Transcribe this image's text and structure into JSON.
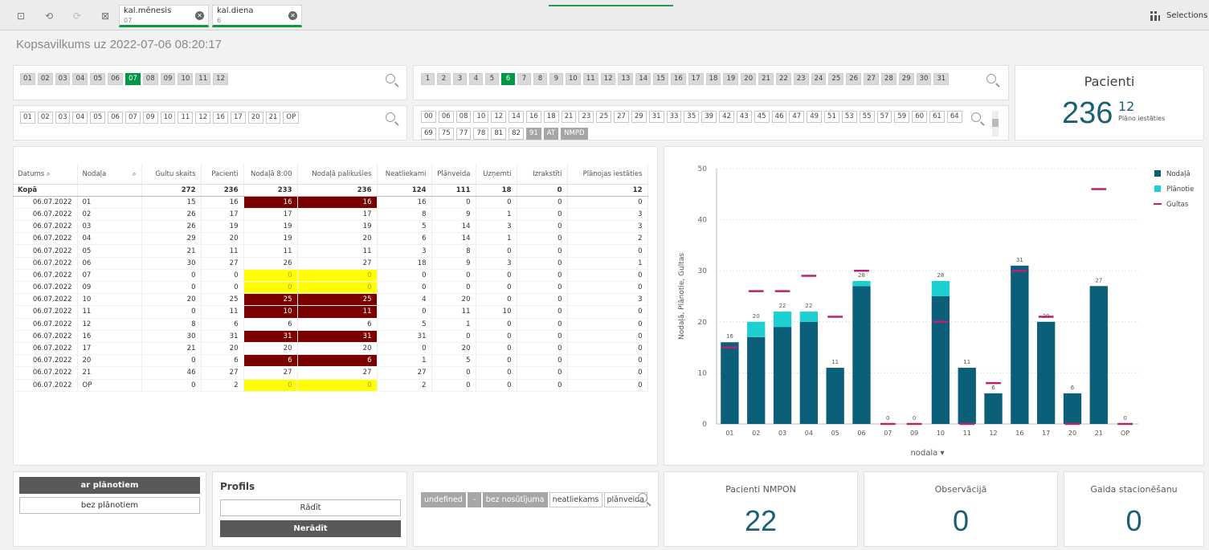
{
  "toolbar": {
    "tabs": [
      {
        "name": "kal.mēnesis",
        "value": "07"
      },
      {
        "name": "kal.diena",
        "value": "6"
      }
    ],
    "selections_label": "Selections"
  },
  "page_title": "Kopsavilkums uz 2022-07-06 08:20:17",
  "filters": {
    "months": [
      "01",
      "02",
      "03",
      "04",
      "05",
      "06",
      "07",
      "08",
      "09",
      "10",
      "11",
      "12"
    ],
    "months_selected": "07",
    "days": [
      "1",
      "2",
      "3",
      "4",
      "5",
      "6",
      "7",
      "8",
      "9",
      "10",
      "11",
      "12",
      "13",
      "14",
      "15",
      "16",
      "17",
      "18",
      "19",
      "20",
      "21",
      "22",
      "23",
      "24",
      "25",
      "26",
      "27",
      "28",
      "29",
      "30",
      "31"
    ],
    "days_selected": "6",
    "departments": [
      "01",
      "02",
      "03",
      "04",
      "05",
      "06",
      "07",
      "09",
      "10",
      "11",
      "12",
      "16",
      "17",
      "20",
      "21",
      "OP"
    ],
    "codes": [
      "00",
      "06",
      "08",
      "10",
      "12",
      "14",
      "16",
      "18",
      "21",
      "23",
      "25",
      "27",
      "29",
      "31",
      "33",
      "35",
      "39",
      "42",
      "43",
      "45",
      "46",
      "47",
      "49",
      "51",
      "53",
      "55",
      "57",
      "59",
      "60",
      "61",
      "64",
      "69",
      "75",
      "77",
      "78",
      "81",
      "82",
      "91",
      "AT",
      "NMPD"
    ]
  },
  "kpi_pacienti": {
    "title": "Pacienti",
    "value": "236",
    "sub_value": "12",
    "sub_label": "Plāno iestāties"
  },
  "table": {
    "headers": [
      "Datums",
      "Nodaļa",
      "Gultu skaits",
      "Pacienti",
      "Nodaļā 8:00",
      "Nodaļā palikušies",
      "Neatliekami",
      "Plānveida",
      "Uzņemti",
      "Izrakstīti",
      "Plānojas iestāties"
    ],
    "total": [
      "Kopā",
      "",
      "272",
      "236",
      "233",
      "236",
      "124",
      "111",
      "18",
      "0",
      "12"
    ],
    "rows": [
      [
        "06.07.2022",
        "01",
        "15",
        "16",
        "16",
        "16",
        "16",
        "0",
        "0",
        "0",
        "0"
      ],
      [
        "06.07.2022",
        "02",
        "26",
        "17",
        "17",
        "17",
        "8",
        "9",
        "1",
        "0",
        "3"
      ],
      [
        "06.07.2022",
        "03",
        "26",
        "19",
        "19",
        "19",
        "5",
        "14",
        "3",
        "0",
        "3"
      ],
      [
        "06.07.2022",
        "04",
        "29",
        "20",
        "19",
        "20",
        "6",
        "14",
        "1",
        "0",
        "2"
      ],
      [
        "06.07.2022",
        "05",
        "21",
        "11",
        "11",
        "11",
        "3",
        "8",
        "0",
        "0",
        "0"
      ],
      [
        "06.07.2022",
        "06",
        "30",
        "27",
        "26",
        "27",
        "18",
        "9",
        "3",
        "0",
        "1"
      ],
      [
        "06.07.2022",
        "07",
        "0",
        "0",
        "0",
        "0",
        "0",
        "0",
        "0",
        "0",
        "0"
      ],
      [
        "06.07.2022",
        "09",
        "0",
        "0",
        "0",
        "0",
        "0",
        "0",
        "0",
        "0",
        "0"
      ],
      [
        "06.07.2022",
        "10",
        "20",
        "25",
        "25",
        "25",
        "4",
        "20",
        "0",
        "0",
        "3"
      ],
      [
        "06.07.2022",
        "11",
        "0",
        "11",
        "10",
        "11",
        "0",
        "11",
        "10",
        "0",
        "0"
      ],
      [
        "06.07.2022",
        "12",
        "8",
        "6",
        "6",
        "6",
        "5",
        "1",
        "0",
        "0",
        "0"
      ],
      [
        "06.07.2022",
        "16",
        "30",
        "31",
        "31",
        "31",
        "31",
        "0",
        "0",
        "0",
        "0"
      ],
      [
        "06.07.2022",
        "17",
        "21",
        "20",
        "20",
        "20",
        "0",
        "20",
        "0",
        "0",
        "0"
      ],
      [
        "06.07.2022",
        "20",
        "0",
        "6",
        "6",
        "6",
        "1",
        "5",
        "0",
        "0",
        "0"
      ],
      [
        "06.07.2022",
        "21",
        "46",
        "27",
        "27",
        "27",
        "27",
        "0",
        "0",
        "0",
        "0"
      ],
      [
        "06.07.2022",
        "OP",
        "0",
        "2",
        "0",
        "0",
        "2",
        "0",
        "0",
        "0",
        "0"
      ]
    ],
    "highlight": [
      "red",
      "none",
      "none",
      "none",
      "none",
      "none",
      "yellow",
      "yellow",
      "red",
      "red",
      "none",
      "red",
      "none",
      "red",
      "none",
      "yellow"
    ]
  },
  "chart_data": {
    "type": "bar",
    "categories": [
      "01",
      "02",
      "03",
      "04",
      "05",
      "06",
      "07",
      "09",
      "10",
      "11",
      "12",
      "16",
      "17",
      "20",
      "21",
      "OP"
    ],
    "series": [
      {
        "name": "Nodaļā",
        "values": [
          16,
          17,
          19,
          20,
          11,
          27,
          0,
          0,
          25,
          11,
          6,
          31,
          20,
          6,
          27,
          0
        ],
        "color": "#0b5f78"
      },
      {
        "name": "Plānotie",
        "values": [
          0,
          3,
          3,
          2,
          0,
          1,
          0,
          0,
          3,
          0,
          0,
          0,
          0,
          0,
          0,
          0
        ],
        "color": "#1ecfd1"
      },
      {
        "name": "Gultas",
        "values": [
          15,
          26,
          26,
          29,
          21,
          30,
          0,
          0,
          20,
          0,
          8,
          30,
          21,
          0,
          46,
          0
        ],
        "color": "#b8226e"
      }
    ],
    "totals": [
      16,
      20,
      22,
      22,
      11,
      28,
      0,
      0,
      28,
      11,
      6,
      31,
      20,
      6,
      27,
      0
    ],
    "xlabel": "nodala",
    "ylabel": "Nodaļā, Plānotie, Gultas",
    "ylim": [
      0,
      50
    ],
    "yticks": [
      0,
      10,
      20,
      30,
      40,
      50
    ],
    "legend_position": "right"
  },
  "buttons": {
    "ar_planotiem": "ar plānotiem",
    "bez_planotiem": "bez plānotiem",
    "profils_title": "Profils",
    "radit": "Rādīt",
    "neradit": "Nerādīt"
  },
  "bottom_filter": {
    "chips": [
      "undefined",
      "-",
      "bez nosūtījuma",
      "neatliekams",
      "plānveida"
    ]
  },
  "kpi_nmpon": {
    "title": "Pacienti NMPON",
    "value": "22"
  },
  "kpi_observacija": {
    "title": "Observācijā",
    "value": "0"
  },
  "kpi_gaida": {
    "title": "Gaida stacionēšanu",
    "value": "0"
  }
}
